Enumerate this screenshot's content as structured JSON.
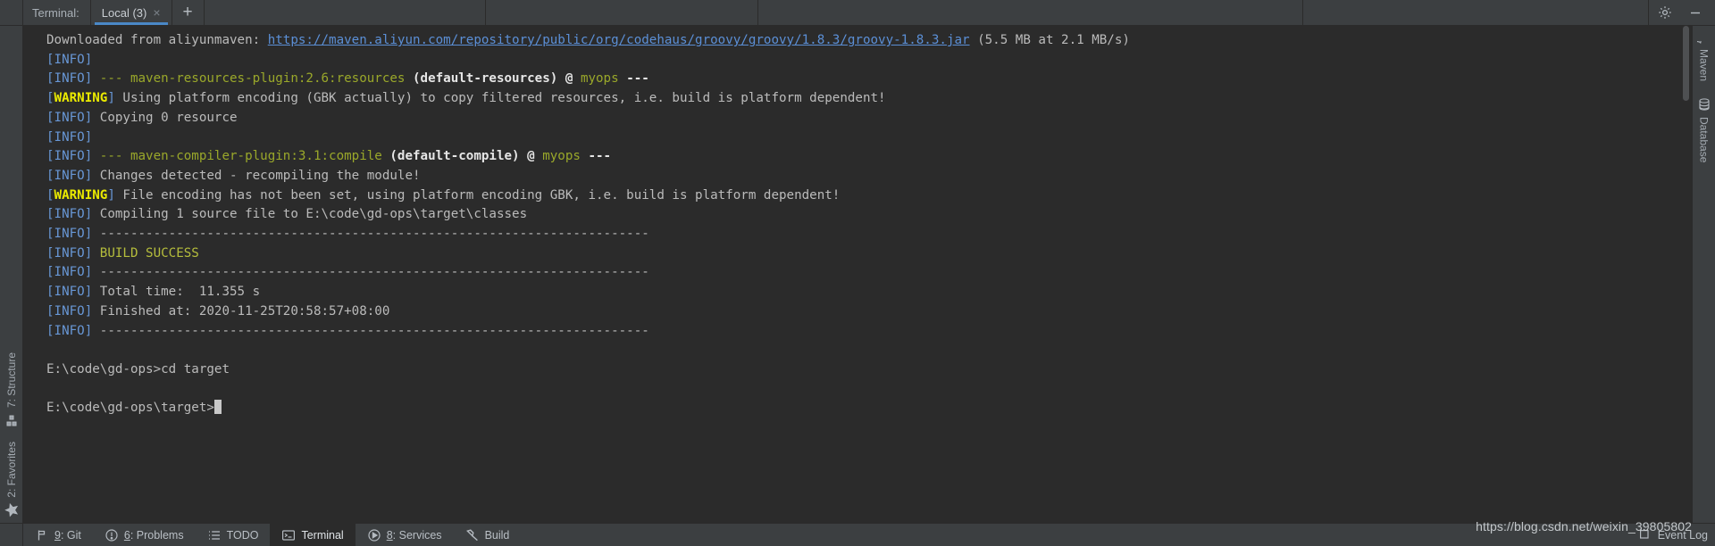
{
  "tabbar": {
    "label": "Terminal:",
    "tab": {
      "title": "Local (3)",
      "close": "×"
    },
    "new_tab": "+",
    "settings_icon": "gear-icon",
    "minimize_icon": "minimize-icon"
  },
  "left_strip": {
    "items": [
      {
        "label": "7: Structure",
        "key": "7",
        "icon": "structure-icon"
      },
      {
        "label": "2: Favorites",
        "key": "2",
        "icon": "star-icon"
      }
    ]
  },
  "right_strip": {
    "items": [
      {
        "label": "Maven",
        "icon": "maven-icon"
      },
      {
        "label": "Database",
        "icon": "database-icon"
      }
    ]
  },
  "terminal": {
    "prompt_caret": "█",
    "lines": [
      {
        "id": "l1",
        "type": "download",
        "prefix": "Downloaded from aliyunmaven: ",
        "link": "https://maven.aliyun.com/repository/public/org/codehaus/groovy/groovy/1.8.3/groovy-1.8.3.jar",
        "suffix": " (5.5 MB at 2.1 MB/s)"
      },
      {
        "id": "l2",
        "type": "info",
        "tag": "[INFO]",
        "text": ""
      },
      {
        "id": "l3",
        "type": "goal",
        "tag": "[INFO]",
        "dashes": " --- ",
        "plugin": "maven-resources-plugin:2.6:resources",
        "exec": " (default-resources)",
        "at": " @ ",
        "module": "myops",
        "tail": " ---"
      },
      {
        "id": "l4",
        "type": "warn",
        "tag": "[WARNING]",
        "text": " Using platform encoding (GBK actually) to copy filtered resources, i.e. build is platform dependent!"
      },
      {
        "id": "l5",
        "type": "info",
        "tag": "[INFO]",
        "text": " Copying 0 resource"
      },
      {
        "id": "l6",
        "type": "info",
        "tag": "[INFO]",
        "text": ""
      },
      {
        "id": "l7",
        "type": "goal",
        "tag": "[INFO]",
        "dashes": " --- ",
        "plugin": "maven-compiler-plugin:3.1:compile",
        "exec": " (default-compile)",
        "at": " @ ",
        "module": "myops",
        "tail": " ---"
      },
      {
        "id": "l8",
        "type": "info",
        "tag": "[INFO]",
        "text": " Changes detected - recompiling the module!"
      },
      {
        "id": "l9",
        "type": "warn",
        "tag": "[WARNING]",
        "text": " File encoding has not been set, using platform encoding GBK, i.e. build is platform dependent!"
      },
      {
        "id": "l10",
        "type": "info",
        "tag": "[INFO]",
        "text": " Compiling 1 source file to E:\\code\\gd-ops\\target\\classes"
      },
      {
        "id": "l11",
        "type": "rule",
        "tag": "[INFO]",
        "text": " ------------------------------------------------------------------------"
      },
      {
        "id": "l12",
        "type": "success",
        "tag": "[INFO]",
        "text": " BUILD SUCCESS"
      },
      {
        "id": "l13",
        "type": "rule",
        "tag": "[INFO]",
        "text": " ------------------------------------------------------------------------"
      },
      {
        "id": "l14",
        "type": "info",
        "tag": "[INFO]",
        "text": " Total time:  11.355 s"
      },
      {
        "id": "l15",
        "type": "info",
        "tag": "[INFO]",
        "text": " Finished at: 2020-11-25T20:58:57+08:00"
      },
      {
        "id": "l16",
        "type": "rule",
        "tag": "[INFO]",
        "text": " ------------------------------------------------------------------------"
      },
      {
        "id": "l17",
        "type": "blank",
        "text": ""
      },
      {
        "id": "l18",
        "type": "cmd",
        "text": "E:\\code\\gd-ops>cd target"
      },
      {
        "id": "l19",
        "type": "blank",
        "text": ""
      },
      {
        "id": "l20",
        "type": "prompt",
        "text": "E:\\code\\gd-ops\\target>"
      }
    ]
  },
  "statusbar": {
    "items": [
      {
        "label": "9: Git",
        "key": "9",
        "rest": ": Git",
        "icon": "git-branch-icon",
        "active": false
      },
      {
        "label": "6: Problems",
        "key": "6",
        "rest": ": Problems",
        "icon": "problems-icon",
        "active": false
      },
      {
        "label": "TODO",
        "key": "",
        "rest": "TODO",
        "icon": "todo-list-icon",
        "active": false
      },
      {
        "label": "Terminal",
        "key": "",
        "rest": "Terminal",
        "icon": "terminal-icon",
        "active": true
      },
      {
        "label": "8: Services",
        "key": "8",
        "rest": ": Services",
        "icon": "services-play-icon",
        "active": false
      },
      {
        "label": "Build",
        "key": "",
        "rest": "Build",
        "icon": "hammer-icon",
        "active": false
      }
    ],
    "event_log": "Event Log",
    "event_log_icon": "event-log-icon"
  },
  "watermark": {
    "text": "https://blog.csdn.net/weixin_39805802"
  },
  "colors": {
    "terminal_bg": "#2b2b2b",
    "chrome_bg": "#3c3f41",
    "info_blue": "#6897d6",
    "warning_yellow": "#eaea00",
    "plugin_olive": "#9aa82a",
    "success_green": "#b5bd3c",
    "link_blue": "#5b8fd6",
    "tab_underline": "#4a88c7",
    "default_text": "#bbbbbb"
  }
}
